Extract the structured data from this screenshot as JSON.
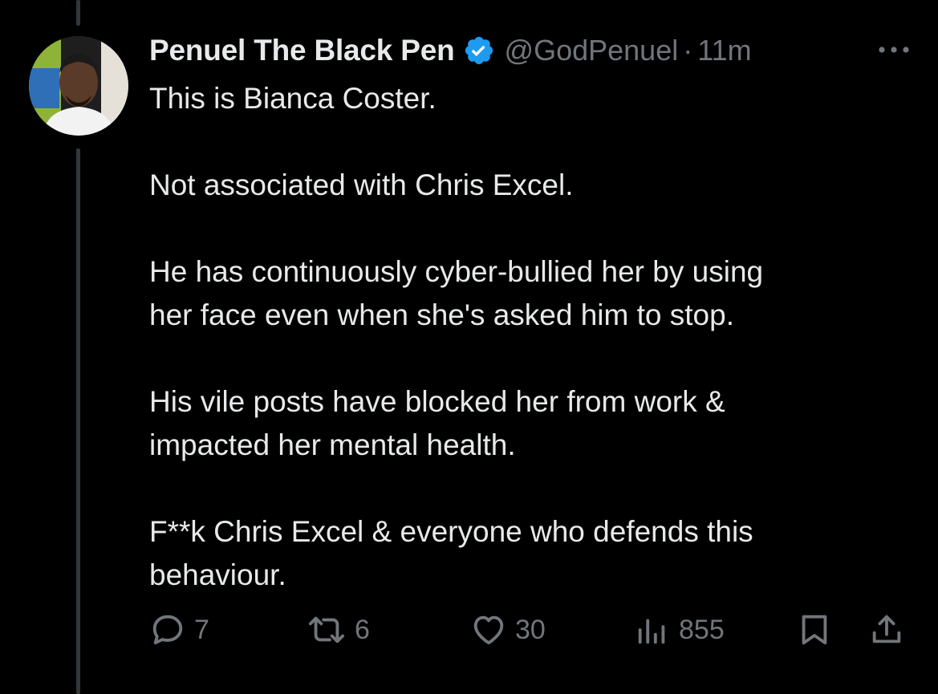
{
  "tweet": {
    "author": {
      "display_name": "Penuel The Black Pen",
      "handle": "@GodPenuel",
      "verified": true,
      "avatar": "profile-photo"
    },
    "separator": "·",
    "time": "11m",
    "paragraphs": [
      "This is Bianca Coster.",
      "Not associated with Chris Excel.",
      "He has continuously cyber-bullied her by using\nher face even when she's asked him to stop.",
      "His vile posts have blocked her from work &\nimpacted her mental health.",
      "F**k Chris Excel & everyone who defends this\nbehaviour."
    ],
    "metrics": {
      "replies": "7",
      "reposts": "6",
      "likes": "30",
      "views": "855"
    }
  },
  "icons": {
    "verified": "verified-badge-icon",
    "more": "more-dots-icon",
    "reply": "reply-icon",
    "repost": "repost-icon",
    "like": "heart-icon",
    "views": "views-chart-icon",
    "bookmark": "bookmark-icon",
    "share": "share-icon"
  },
  "colors": {
    "background": "#000000",
    "text_primary": "#e7e9ea",
    "text_secondary": "#71767b",
    "verified_blue": "#1d9bf0",
    "thread_line": "#333639"
  }
}
